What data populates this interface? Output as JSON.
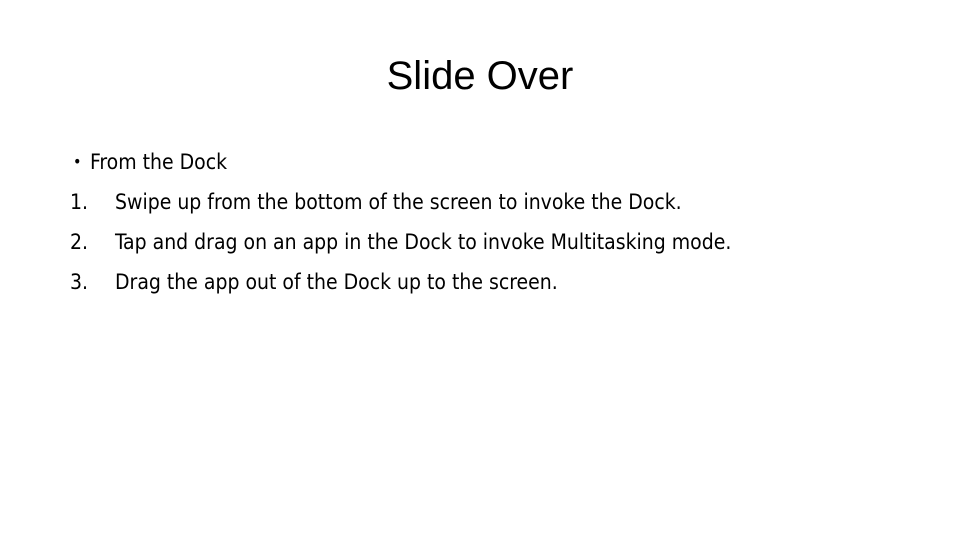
{
  "slide": {
    "title": "Slide Over",
    "background_color": "#FFFFFF",
    "text_color": "#000000",
    "body": {
      "bullet": {
        "marker": "•",
        "text": "From the Dock"
      },
      "steps": [
        {
          "marker": "1.",
          "text": "Swipe up from the bottom of the screen to invoke the Dock."
        },
        {
          "marker": "2.",
          "text": "Tap and drag on an app in the Dock to invoke Multitasking mode."
        },
        {
          "marker": "3.",
          "text": "Drag the app out of the Dock up to the screen."
        }
      ]
    }
  }
}
